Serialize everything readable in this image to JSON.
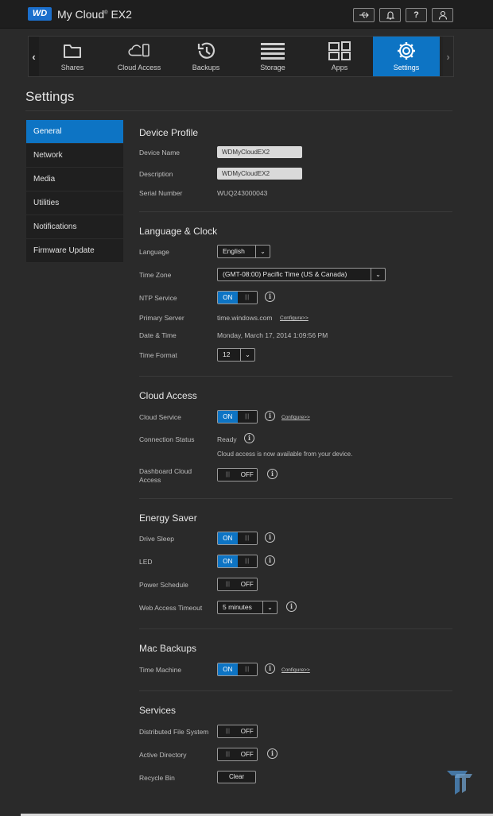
{
  "header": {
    "logo": "WD",
    "brand_main": "My Cloud",
    "brand_sup": "®",
    "brand_model": "EX2",
    "icons": [
      "usb-icon",
      "bell-icon",
      "help-icon",
      "user-icon"
    ],
    "help_glyph": "?"
  },
  "nav": {
    "items": [
      {
        "label": "Shares",
        "icon": "folder-icon"
      },
      {
        "label": "Cloud Access",
        "icon": "cloud-device-icon"
      },
      {
        "label": "Backups",
        "icon": "history-icon"
      },
      {
        "label": "Storage",
        "icon": "storage-icon"
      },
      {
        "label": "Apps",
        "icon": "apps-icon"
      },
      {
        "label": "Settings",
        "icon": "gear-icon",
        "active": true
      }
    ],
    "left_arrow": "‹",
    "right_arrow": "›"
  },
  "page": {
    "title": "Settings"
  },
  "sidebar": {
    "items": [
      {
        "label": "General",
        "active": true
      },
      {
        "label": "Network"
      },
      {
        "label": "Media"
      },
      {
        "label": "Utilities"
      },
      {
        "label": "Notifications"
      },
      {
        "label": "Firmware Update"
      }
    ]
  },
  "device_profile": {
    "title": "Device Profile",
    "device_name_label": "Device Name",
    "device_name_value": "WDMyCloudEX2",
    "description_label": "Description",
    "description_value": "WDMyCloudEX2",
    "serial_label": "Serial Number",
    "serial_value": "WUQ243000043"
  },
  "language_clock": {
    "title": "Language & Clock",
    "language_label": "Language",
    "language_value": "English",
    "timezone_label": "Time Zone",
    "timezone_value": "(GMT-08:00) Pacific Time (US & Canada)",
    "ntp_label": "NTP Service",
    "ntp_state": "ON",
    "primary_server_label": "Primary Server",
    "primary_server_value": "time.windows.com",
    "configure_link": "Configure>>",
    "datetime_label": "Date & Time",
    "datetime_value": "Monday, March 17, 2014 1:09:56 PM",
    "time_format_label": "Time Format",
    "time_format_value": "12"
  },
  "cloud_access": {
    "title": "Cloud Access",
    "service_label": "Cloud Service",
    "service_state": "ON",
    "configure_link": "Configure>>",
    "status_label": "Connection Status",
    "status_value": "Ready",
    "status_note": "Cloud access is now available from your device.",
    "dashboard_label_1": "Dashboard Cloud",
    "dashboard_label_2": "Access",
    "dashboard_state": "OFF"
  },
  "energy_saver": {
    "title": "Energy Saver",
    "drive_sleep_label": "Drive Sleep",
    "drive_sleep_state": "ON",
    "led_label": "LED",
    "led_state": "ON",
    "power_schedule_label": "Power Schedule",
    "power_schedule_state": "OFF",
    "web_timeout_label": "Web Access Timeout",
    "web_timeout_value": "5 minutes"
  },
  "mac_backups": {
    "title": "Mac Backups",
    "time_machine_label": "Time Machine",
    "time_machine_state": "ON",
    "configure_link": "Configure>>"
  },
  "services": {
    "title": "Services",
    "dfs_label": "Distributed File System",
    "dfs_state": "OFF",
    "ad_label": "Active Directory",
    "ad_state": "OFF",
    "recycle_label": "Recycle Bin",
    "recycle_button": "Clear"
  },
  "glyphs": {
    "info": "i",
    "grip": "|||",
    "chevron": "⌄"
  },
  "colors": {
    "accent": "#0d74c4",
    "background": "#2a2a2a"
  }
}
